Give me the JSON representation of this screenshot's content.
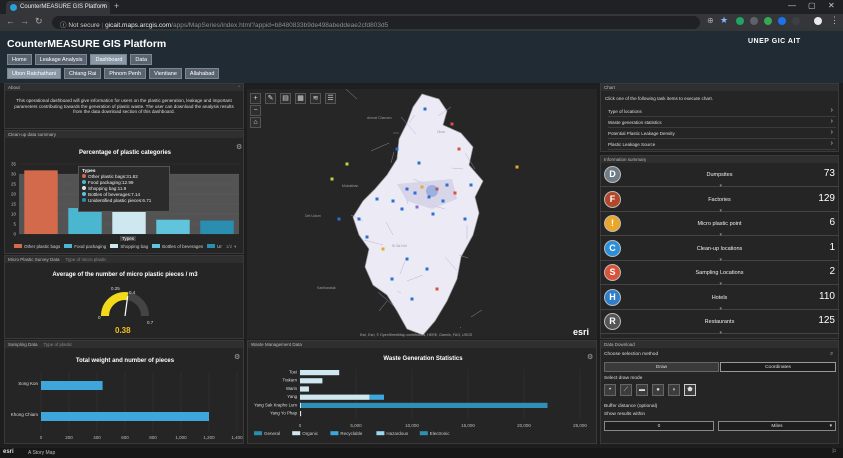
{
  "browser": {
    "tab_title": "CounterMEASURE GIS Platform",
    "url_security": "Not secure",
    "url_host": "gicait.maps.arcgis.com",
    "url_path": "/apps/MapSeries/index.html?appid=b8480833b9de498abeddeae2cfd803d5"
  },
  "app": {
    "title": "CounterMEASURE GIS Platform",
    "nav_row1": [
      "Home",
      "Leakage Analysis",
      "Dashboard",
      "Data"
    ],
    "nav_row1_active": "Dashboard",
    "nav_row2": [
      "Ubon Ratchathani",
      "Chiang Rai",
      "Phnom Penh",
      "Vientiane",
      "Allahabad"
    ],
    "nav_row2_active": "Ubon Ratchathani",
    "logos_text": "UNEP  GIC  AIT"
  },
  "about": {
    "title": "About",
    "text": "This operational dashboard will give information for users on the plastic generation, leakage and important parameters contributing towards the generation of plastic waste. The user can download the analysis results from the data download section of this dashboard."
  },
  "cleanup": {
    "panel_title": "Clean-up data summary",
    "chart_title": "Percentage of plastic categories",
    "tooltip_title": "Types",
    "tooltip_items": [
      "Other plastic bags:31.82",
      "Food packaging:12.99",
      "Shopping bag:11.9",
      "Bottles of beverages:7.14",
      "Unidentified plastic pieces:6.71"
    ],
    "xlabel_hover": "Types",
    "legend": [
      "Other plastic bags",
      "Food packaging",
      "Shopping bag",
      "Bottles of beverages",
      "Ur"
    ],
    "legend_page": "1/2"
  },
  "micro": {
    "panel_title": "Micro Plastic Survey Data",
    "filter_label": "Type of micro plastic",
    "chart_title": "Average of the number of micro plastic pieces / m3",
    "gauge_value": "0.38",
    "gauge_value_num": 0.38,
    "gauge_ticks": [
      "0",
      "0.25",
      "0.4",
      "0.7"
    ]
  },
  "sampling": {
    "panel_title": "Sampling Data",
    "filter_label": "Type of plastic",
    "chart_title": "Total weight and number of pieces"
  },
  "waste": {
    "panel_title": "Waste Management Data",
    "chart_title": "Waste Generation Statistics",
    "legend": [
      "General",
      "Organic",
      "Recyclable",
      "Hazardous",
      "Electronic"
    ]
  },
  "map": {
    "attribution": "Esri, Esri, © OpenStreetMap contributors, HERE, Garmin, FAO, USGS",
    "brand": "esri",
    "place_labels": [
      "Amnat Charoen",
      "Ubon",
      "Det Udom",
      "Kantharalak",
      "Si Sa Ket",
      "Mukdahan"
    ]
  },
  "chart_panel": {
    "title": "Chart",
    "instruction": "Click one of the following task items to execute chart.",
    "items": [
      "Type of locations",
      "Waste generation statistics",
      "Potential Plastic Leakage Density",
      "Plastic Leakage Source"
    ]
  },
  "info": {
    "title": "Information summary",
    "rows": [
      {
        "label": "Dumpsites",
        "value": "73",
        "icon": "D",
        "color": "#6f7c86"
      },
      {
        "label": "Factories",
        "value": "129",
        "icon": "F",
        "color": "#b2472a"
      },
      {
        "label": "Micro plastic point",
        "value": "6",
        "icon": "!",
        "color": "#e9a62a"
      },
      {
        "label": "Clean-up locations",
        "value": "1",
        "icon": "C",
        "color": "#2e8fd9"
      },
      {
        "label": "Sampling Locations",
        "value": "2",
        "icon": "S",
        "color": "#d9533b"
      },
      {
        "label": "Hotels",
        "value": "110",
        "icon": "H",
        "color": "#2e7ec9"
      },
      {
        "label": "Restaurants",
        "value": "125",
        "icon": "R",
        "color": "#555"
      }
    ]
  },
  "download": {
    "title": "Data Download",
    "choose": "Choose selection method",
    "tabs": [
      "Draw",
      "Coordinates"
    ],
    "draw_mode": "Select draw mode",
    "buffer": "Buffer distance (optional)",
    "show": "Show results within",
    "distance_value": "0",
    "unit": "Miles"
  },
  "footer": {
    "brand": "esri",
    "story": "A Story Map"
  },
  "chart_data": [
    {
      "type": "bar",
      "title": "Percentage of plastic categories",
      "xlabel": "Types",
      "categories": [
        "Other plastic bags",
        "Food packaging",
        "Shopping bag",
        "Bottles of beverages",
        "Unidentified plastic pieces"
      ],
      "values": [
        31.82,
        12.99,
        11.9,
        7.14,
        6.71
      ],
      "colors": [
        "#d46a4c",
        "#4bb6cf",
        "#cfe8f0",
        "#5fc4dc",
        "#2a8eb0"
      ],
      "yticks": [
        0,
        5,
        10,
        15,
        20,
        25,
        30,
        35
      ],
      "ylim": [
        0,
        35
      ]
    },
    {
      "type": "bar",
      "orientation": "horizontal",
      "title": "Total weight and number of pieces",
      "categories": [
        "Song Kon",
        "Khong Chiam"
      ],
      "values": [
        440,
        1200
      ],
      "xticks": [
        "0",
        "200",
        "400",
        "600",
        "800",
        "1,000",
        "1,200",
        "1,400"
      ],
      "xlim": [
        0,
        1400
      ]
    },
    {
      "type": "bar",
      "orientation": "horizontal",
      "stacked": true,
      "title": "Waste Generation Statistics",
      "categories": [
        "Toei",
        "Trakarn",
        "Warin",
        "Yang",
        "Yang Sak Krapho Lum",
        "Yang Yo Phap"
      ],
      "series": [
        {
          "name": "General",
          "values": [
            0,
            0,
            0,
            0,
            0,
            0
          ]
        },
        {
          "name": "Organic",
          "values": [
            3500,
            2000,
            800,
            6200,
            100,
            100
          ]
        },
        {
          "name": "Recyclable",
          "values": [
            0,
            0,
            0,
            1300,
            0,
            0
          ]
        },
        {
          "name": "Hazardous",
          "values": [
            0,
            0,
            0,
            0,
            0,
            0
          ]
        },
        {
          "name": "Electronic",
          "values": [
            0,
            0,
            0,
            0,
            22000,
            0
          ]
        }
      ],
      "xticks": [
        "0",
        "5,000",
        "10,000",
        "15,000",
        "20,000",
        "25,000"
      ],
      "xlim": [
        0,
        25000
      ]
    }
  ]
}
